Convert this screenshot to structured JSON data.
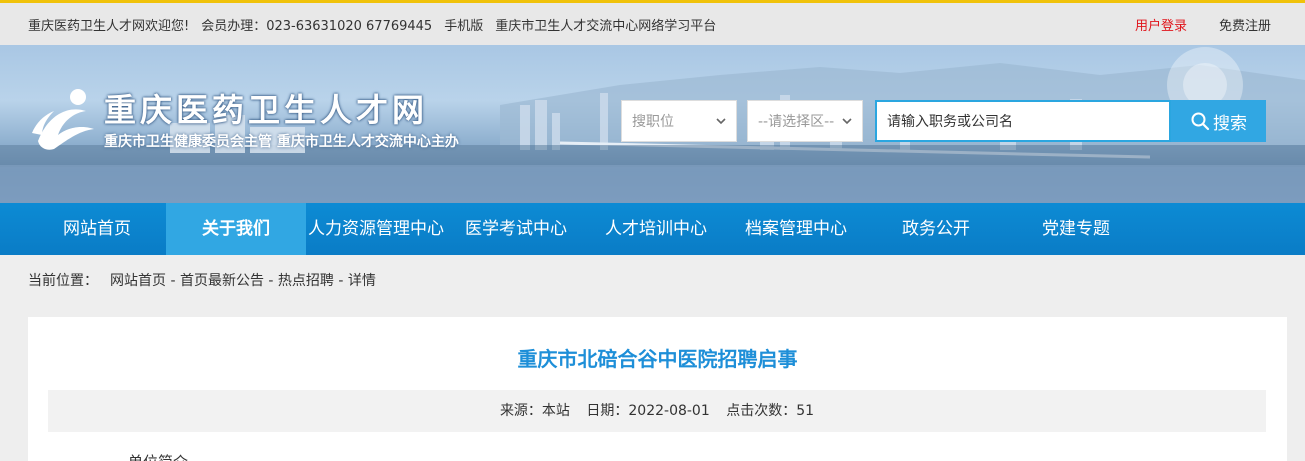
{
  "topbar": {
    "welcome": "重庆医药卫生人才网欢迎您!",
    "member": "会员办理：023-63631020 67769445",
    "mobile": "手机版",
    "platform": "重庆市卫生人才交流中心网络学习平台",
    "login": "用户登录",
    "register": "免费注册",
    "accent_color": "#f0c20a"
  },
  "header": {
    "logo_title": "重庆医药卫生人才网",
    "logo_subtitle": "重庆市卫生健康委员会主管  重庆市卫生人才交流中心主办",
    "search": {
      "job_select": "搜职位",
      "area_select": "--请选择区--",
      "input_placeholder": "请输入职务或公司名",
      "button_label": "搜索",
      "button_icon": "search-icon"
    }
  },
  "nav": {
    "items": [
      {
        "label": "网站首页",
        "active": false
      },
      {
        "label": "关于我们",
        "active": true
      },
      {
        "label": "人力资源管理中心",
        "active": false
      },
      {
        "label": "医学考试中心",
        "active": false
      },
      {
        "label": "人才培训中心",
        "active": false
      },
      {
        "label": "档案管理中心",
        "active": false
      },
      {
        "label": "政务公开",
        "active": false
      },
      {
        "label": "党建专题",
        "active": false
      }
    ],
    "color": "#0d8bd4",
    "active_color": "#31a7e3"
  },
  "breadcrumb": {
    "label": "当前位置：",
    "items": [
      "网站首页",
      "首页最新公告",
      "热点招聘",
      "详情"
    ],
    "separator": " - "
  },
  "article": {
    "title": "重庆市北碚合谷中医院招聘启事",
    "source": "来源：本站",
    "date": "日期：2022-08-01",
    "clicks": "点击次数：51",
    "section_heading": "单位简介",
    "title_color": "#1e8fd8"
  }
}
